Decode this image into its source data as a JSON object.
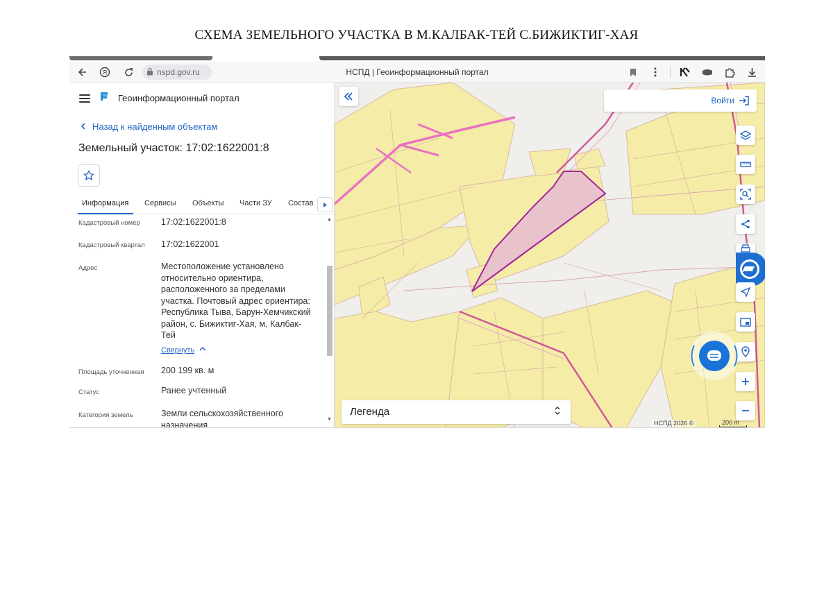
{
  "document": {
    "title": "СХЕМА ЗЕМЕЛЬНОГО УЧАСТКА В М.КАЛБАК-ТЕЙ С.БИЖИКТИГ-ХАЯ"
  },
  "browser": {
    "url": "nspd.gov.ru",
    "tab_title": "НСПД | Геоинформационный портал",
    "icons": [
      "back-icon",
      "yandex-icon",
      "reload-icon",
      "lock-icon",
      "bookmark-icon",
      "more-icon",
      "extension-k-icon",
      "extension-hat-icon",
      "extension-puzzle-icon",
      "download-icon"
    ]
  },
  "panel": {
    "portal_name": "Геоинформационный портал",
    "back_link": "Назад к найденным объектам",
    "object_title": "Земельный участок: 17:02:1622001:8",
    "tabs": [
      "Информация",
      "Сервисы",
      "Объекты",
      "Части ЗУ",
      "Состав"
    ],
    "active_tab": "Информация",
    "properties": {
      "cadastral_number": {
        "label": "Кадастровый номер",
        "value": "17:02:1622001:8"
      },
      "cadastral_quarter": {
        "label": "Кадастровый квартал",
        "value": "17:02:1622001"
      },
      "address": {
        "label": "Адрес",
        "lines": [
          "Местоположение установлено",
          "относительно ориентира,",
          "расположенного за пределами",
          "участка. Почтовый адрес ориентира:",
          "Республика Тыва, Барун-Хемчикский",
          "район, с. Бижиктиг-Хая, м. Калбак-",
          "Тей"
        ],
        "collapse_label": "Свернуть"
      },
      "area": {
        "label": "Площадь уточненная",
        "value": "200 199 кв. м"
      },
      "status": {
        "label": "Статус",
        "value": "Ранее учтенный"
      },
      "land_category": {
        "label": "Категория земель",
        "value": "Земли сельскохозяйственного",
        "value_cont": "назначения"
      }
    }
  },
  "map": {
    "login_label": "Войти",
    "legend_label": "Легенда",
    "copyright": "НСПД 2026 ©",
    "scale": "200 m",
    "colors": {
      "parcel_fill": "#f5eca8",
      "parcel_stroke": "#d9bba0",
      "boundary": "#cf5a97",
      "pink_road": "#ea72c0",
      "selected_fill": "#e9c3cb",
      "selected_stroke": "#a4269b",
      "accent": "#2366c4"
    },
    "controls": [
      "layers-icon",
      "ruler-icon",
      "select-area-icon",
      "share-icon",
      "print-icon",
      "navigate-icon",
      "minimap-icon",
      "location-icon",
      "zoom-in-icon",
      "zoom-out-icon"
    ]
  }
}
